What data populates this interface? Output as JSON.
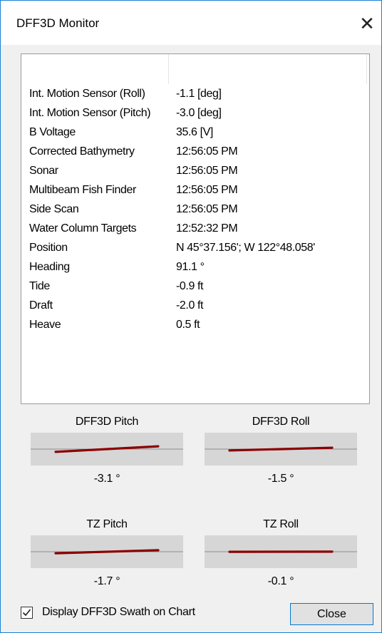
{
  "window": {
    "title": "DFF3D Monitor",
    "close_glyph": "✕"
  },
  "sensor_list": {
    "rows": [
      {
        "name": "Int. Motion Sensor (Roll)",
        "value": "-1.1  [deg]"
      },
      {
        "name": "Int. Motion Sensor (Pitch)",
        "value": "-3.0  [deg]"
      },
      {
        "name": "B Voltage",
        "value": "35.6  [V]"
      },
      {
        "name": "Corrected Bathymetry",
        "value": "12:56:05 PM"
      },
      {
        "name": "Sonar",
        "value": "12:56:05 PM"
      },
      {
        "name": "Multibeam Fish Finder",
        "value": "12:56:05 PM"
      },
      {
        "name": "Side Scan",
        "value": "12:56:05 PM"
      },
      {
        "name": "Water Column Targets",
        "value": "12:52:32 PM"
      },
      {
        "name": "Position",
        "value": "N 45°37.156'; W 122°48.058'"
      },
      {
        "name": "Heading",
        "value": "91.1 °"
      },
      {
        "name": "Tide",
        "value": "-0.9 ft"
      },
      {
        "name": "Draft",
        "value": "-2.0 ft"
      },
      {
        "name": "Heave",
        "value": "0.5 ft"
      }
    ]
  },
  "gauges": [
    {
      "label": "DFF3D Pitch",
      "value_text": "-3.1 °",
      "angle_deg": -3.1
    },
    {
      "label": "DFF3D Roll",
      "value_text": "-1.5 °",
      "angle_deg": -1.5
    },
    {
      "label": "TZ Pitch",
      "value_text": "-1.7 °",
      "angle_deg": -1.7
    },
    {
      "label": "TZ Roll",
      "value_text": "-0.1 °",
      "angle_deg": -0.1
    }
  ],
  "footer": {
    "checkbox_label": "Display DFF3D Swath on Chart",
    "checkbox_checked": true,
    "close_button_label": "Close"
  },
  "colors": {
    "window_border": "#1883d7",
    "gauge_line": "#8b0000",
    "gauge_bg": "#d6d6d6",
    "button_border": "#0078d7"
  }
}
